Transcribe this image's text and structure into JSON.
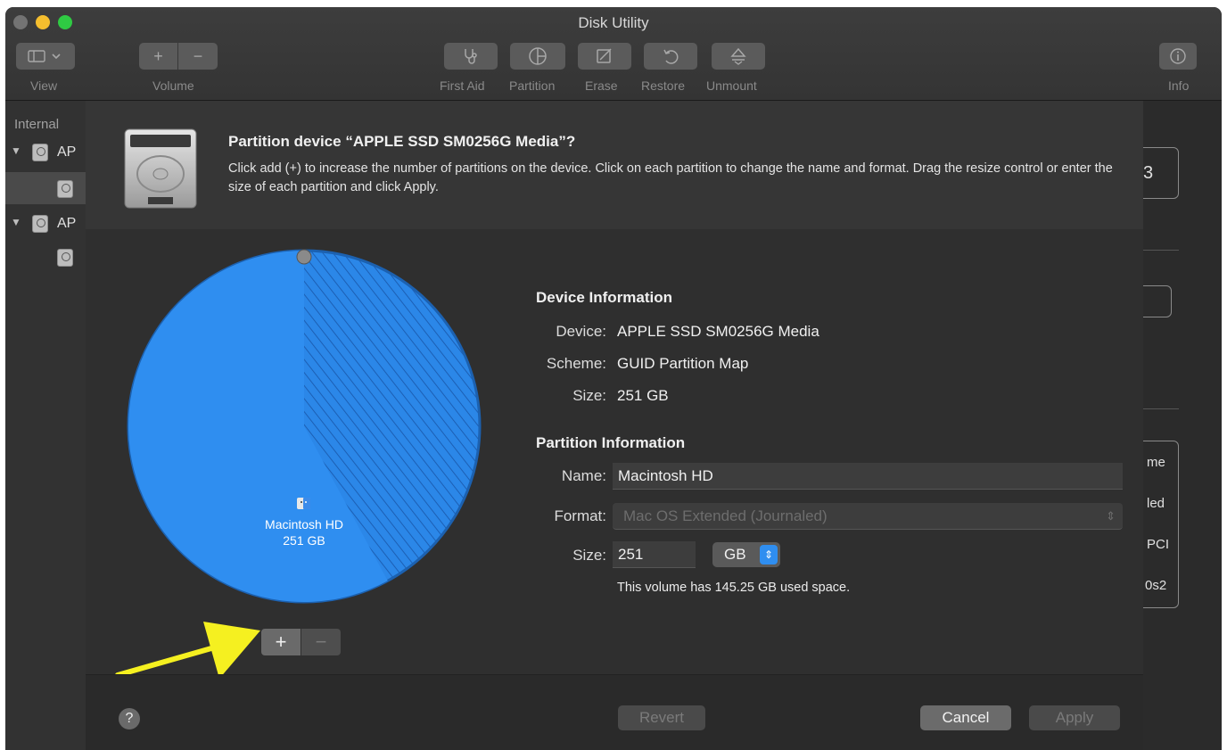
{
  "window": {
    "title": "Disk Utility"
  },
  "toolbar": {
    "view_label": "View",
    "volume_label": "Volume",
    "add_symbol": "+",
    "remove_symbol": "−",
    "first_aid_label": "First Aid",
    "partition_label": "Partition",
    "erase_label": "Erase",
    "restore_label": "Restore",
    "unmount_label": "Unmount",
    "info_label": "Info"
  },
  "sidebar": {
    "header": "Internal",
    "items": [
      {
        "label": "AP"
      },
      {
        "label": "AP"
      }
    ]
  },
  "background_panel": {
    "fragments": [
      "3",
      "me",
      "led",
      "PCI",
      "0s2"
    ]
  },
  "sheet": {
    "title": "Partition device “APPLE SSD SM0256G Media”?",
    "description": "Click add (+) to increase the number of partitions on the device. Click on each partition to change the name and format. Drag the resize control or enter the size of each partition and click Apply.",
    "device_info": {
      "heading": "Device Information",
      "device_label": "Device:",
      "device_value": "APPLE SSD SM0256G Media",
      "scheme_label": "Scheme:",
      "scheme_value": "GUID Partition Map",
      "size_label": "Size:",
      "size_value": "251 GB"
    },
    "partition_info": {
      "heading": "Partition Information",
      "name_label": "Name:",
      "name_value": "Macintosh HD",
      "format_label": "Format:",
      "format_value": "Mac OS Extended (Journaled)",
      "size_label": "Size:",
      "size_value": "251",
      "unit_value": "GB",
      "note": "This volume has 145.25 GB used space."
    },
    "pie": {
      "partition_name": "Macintosh HD",
      "partition_size": "251 GB",
      "used_fraction": 0.579,
      "fill_color": "#2f8ef0",
      "add_symbol": "+",
      "remove_symbol": "−"
    },
    "footer": {
      "help_label": "?",
      "revert_label": "Revert",
      "cancel_label": "Cancel",
      "apply_label": "Apply"
    }
  },
  "colors": {
    "accent": "#2f8ef0",
    "arrow": "#f5f020"
  }
}
